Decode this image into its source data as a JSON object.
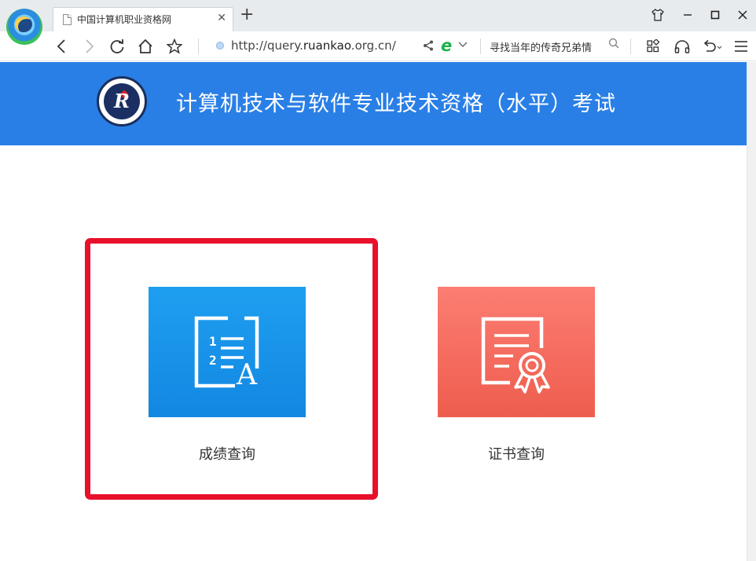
{
  "browser": {
    "tab_title": "中国计算机职业资格网",
    "tab_close": "✕",
    "new_tab": "+",
    "url_prefix": "http://query.",
    "url_domain": "ruankao",
    "url_suffix": ".org.cn/",
    "search_text": "寻找当年的传奇兄弟情",
    "icons": {
      "back": "back-icon",
      "forward": "forward-icon",
      "refresh": "refresh-icon",
      "home": "home-icon",
      "favorite": "star-icon",
      "share": "share-icon",
      "ie_mode": "ie-icon",
      "apps": "apps-icon",
      "headset": "headset-icon",
      "undo": "undo-icon",
      "menu": "menu-icon"
    }
  },
  "header": {
    "title": "计算机技术与软件专业技术资格（水平）考试",
    "bg_color": "#2a7fe6"
  },
  "cards": [
    {
      "label": "成绩查询",
      "icon": "score-list-icon",
      "color": "#1a95ec"
    },
    {
      "label": "证书查询",
      "icon": "certificate-icon",
      "color": "#f46c5f"
    }
  ],
  "highlight": {
    "color": "#e8102a"
  }
}
